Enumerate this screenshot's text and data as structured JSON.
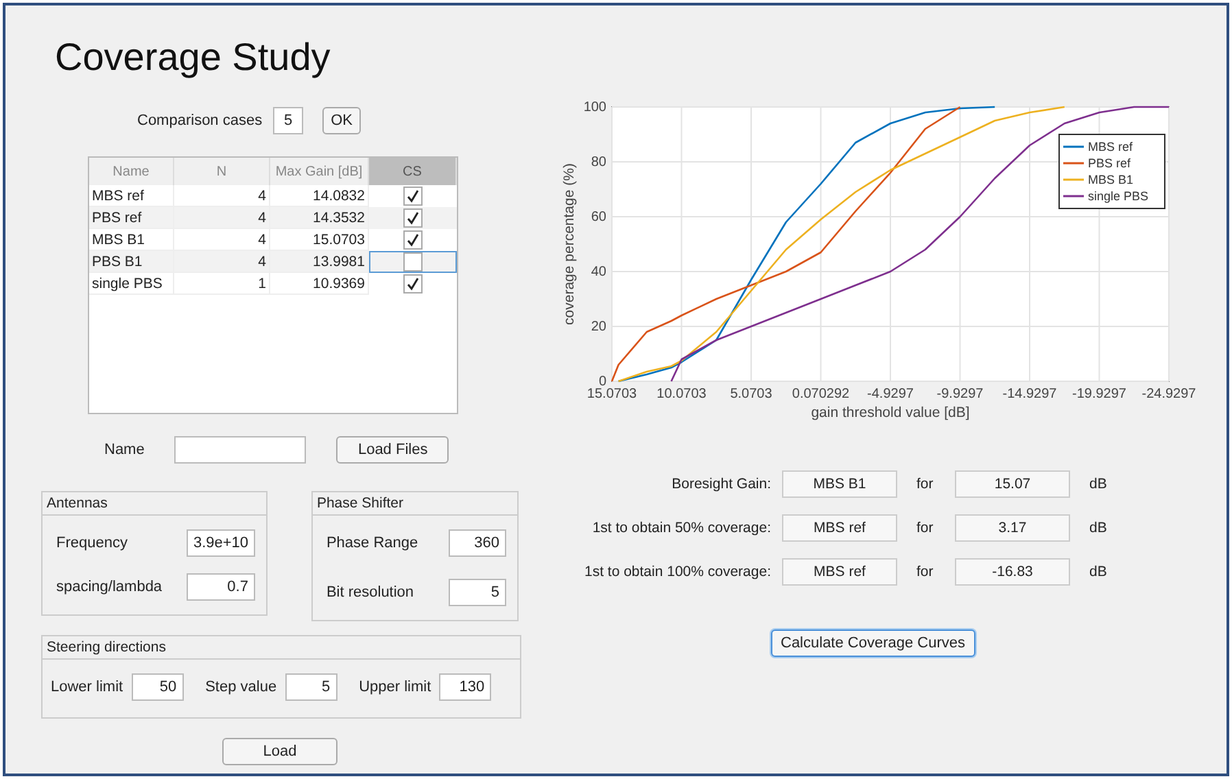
{
  "title": "Coverage Study",
  "comparison": {
    "label": "Comparison cases",
    "value": "5",
    "button": "OK"
  },
  "table": {
    "columns": [
      "Name",
      "N",
      "Max Gain [dB]",
      "CS"
    ],
    "rows": [
      {
        "name": "MBS ref",
        "n": "4",
        "max_gain": "14.0832",
        "checked": true,
        "selected": false
      },
      {
        "name": "PBS ref",
        "n": "4",
        "max_gain": "14.3532",
        "checked": true,
        "selected": false
      },
      {
        "name": "MBS B1",
        "n": "4",
        "max_gain": "15.0703",
        "checked": true,
        "selected": false
      },
      {
        "name": "PBS B1",
        "n": "4",
        "max_gain": "13.9981",
        "checked": false,
        "selected": true
      },
      {
        "name": "single PBS",
        "n": "1",
        "max_gain": "10.9369",
        "checked": true,
        "selected": false
      }
    ]
  },
  "name_field": {
    "label": "Name",
    "button": "Load Files"
  },
  "antennas": {
    "title": "Antennas",
    "fields": [
      {
        "label": "Frequency",
        "value": "3.9e+10"
      },
      {
        "label": "spacing/lambda",
        "value": "0.7"
      }
    ]
  },
  "phase_shifter": {
    "title": "Phase Shifter",
    "fields": [
      {
        "label": "Phase Range",
        "value": "360"
      },
      {
        "label": "Bit resolution",
        "value": "5"
      }
    ]
  },
  "steering": {
    "title": "Steering directions",
    "fields": [
      {
        "label": "Lower limit",
        "value": "50"
      },
      {
        "label": "Step value",
        "value": "5"
      },
      {
        "label": "Upper limit",
        "value": "130"
      }
    ]
  },
  "load_button": "Load",
  "chart_data": {
    "type": "line",
    "xlabel": "gain threshold value [dB]",
    "ylabel": "coverage percentage (%)",
    "x": [
      15.0703,
      14.6,
      12.5703,
      10.8,
      10.0703,
      7.5703,
      5.0703,
      2.5703,
      0.070292,
      -2.4297,
      -4.9297,
      -7.4297,
      -9.9297,
      -12.4297,
      -14.9297,
      -17.4297,
      -19.9297,
      -22.4297,
      -24.9297
    ],
    "series": [
      {
        "name": "MBS ref",
        "color": "#0072bd",
        "values": [
          null,
          0,
          2.5,
          5,
          7,
          15,
          37,
          58,
          72,
          87,
          94,
          98,
          99.5,
          100,
          null,
          null,
          null,
          null,
          null
        ]
      },
      {
        "name": "PBS ref",
        "color": "#d95319",
        "values": [
          0,
          6,
          18,
          22,
          24,
          30,
          35,
          40,
          47,
          62,
          76,
          92,
          100,
          null,
          null,
          null,
          null,
          null,
          null
        ]
      },
      {
        "name": "MBS B1",
        "color": "#edb120",
        "values": [
          null,
          0,
          3.5,
          5.5,
          7.5,
          18,
          33,
          48,
          59,
          69,
          77,
          83,
          89,
          95,
          98,
          100,
          null,
          null,
          null
        ]
      },
      {
        "name": "single PBS",
        "color": "#7e2f8e",
        "values": [
          null,
          null,
          null,
          0,
          8,
          15,
          20,
          25,
          30,
          35,
          40,
          48,
          60,
          74,
          86,
          94,
          98,
          100,
          100
        ]
      }
    ],
    "grid": true,
    "legend": true,
    "xlim": [
      15.0703,
      -24.9297
    ],
    "ylim": [
      0,
      100
    ],
    "xticks": [
      {
        "value": 15.0703,
        "label": "15.0703"
      },
      {
        "value": 10.0703,
        "label": "10.0703"
      },
      {
        "value": 5.0703,
        "label": "5.0703"
      },
      {
        "value": 0.070292,
        "label": "0.070292"
      },
      {
        "value": -4.9297,
        "label": "-4.9297"
      },
      {
        "value": -9.9297,
        "label": "-9.9297"
      },
      {
        "value": -14.9297,
        "label": "-14.9297"
      },
      {
        "value": -19.9297,
        "label": "-19.9297"
      },
      {
        "value": -24.9297,
        "label": "-24.9297"
      }
    ],
    "yticks": [
      0,
      20,
      40,
      60,
      80,
      100
    ]
  },
  "results": [
    {
      "label": "Boresight Gain:",
      "case": "MBS B1",
      "for": "for",
      "value": "15.07",
      "unit": "dB"
    },
    {
      "label": "1st to obtain 50% coverage:",
      "case": "MBS ref",
      "for": "for",
      "value": "3.17",
      "unit": "dB"
    },
    {
      "label": "1st to obtain 100% coverage:",
      "case": "MBS ref",
      "for": "for",
      "value": "-16.83",
      "unit": "dB"
    }
  ],
  "calculate_button": "Calculate Coverage Curves"
}
